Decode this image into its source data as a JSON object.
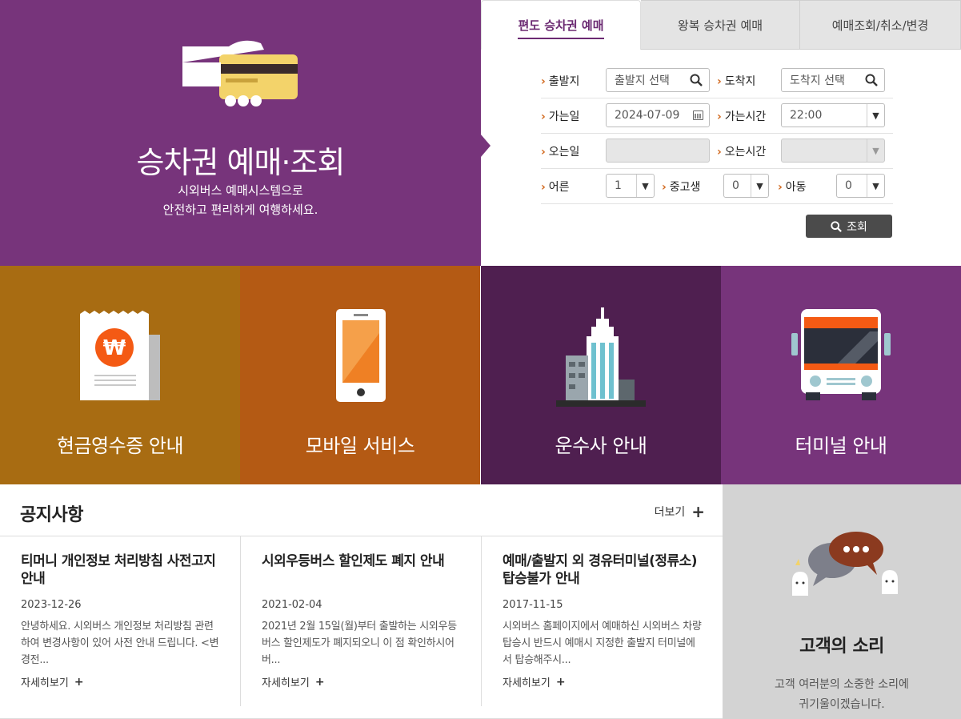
{
  "hero": {
    "title": "승차권 예매·조회",
    "subtitle_line1": "시외버스 예매시스템으로",
    "subtitle_line2": "안전하고 편리하게 여행하세요."
  },
  "tabs": [
    {
      "label": "편도 승차권 예매",
      "active": true
    },
    {
      "label": "왕복 승차권 예매",
      "active": false
    },
    {
      "label": "예매조회/취소/변경",
      "active": false
    }
  ],
  "form": {
    "departure_label": "출발지",
    "departure_placeholder": "출발지 선택",
    "arrival_label": "도착지",
    "arrival_placeholder": "도착지 선택",
    "go_date_label": "가는일",
    "go_date_value": "2024-07-09",
    "go_time_label": "가는시간",
    "go_time_value": "22:00",
    "return_date_label": "오는일",
    "return_time_label": "오는시간",
    "adult_label": "어른",
    "adult_value": "1",
    "student_label": "중고생",
    "student_value": "0",
    "child_label": "아동",
    "child_value": "0",
    "search_label": "조회"
  },
  "tiles": [
    {
      "label": "현금영수증 안내",
      "color": "#a86c12"
    },
    {
      "label": "모바일 서비스",
      "color": "#b45a14"
    },
    {
      "label": "운수사 안내",
      "color": "#4f1f50"
    },
    {
      "label": "터미널 안내",
      "color": "#77347b"
    }
  ],
  "notices": {
    "title": "공지사항",
    "more_label": "더보기",
    "items": [
      {
        "title": "티머니 개인정보 처리방침 사전고지 안내",
        "date": "2023-12-26",
        "body": "안녕하세요. 시외버스 개인정보 처리방침 관련하여 변경사항이 있어 사전 안내 드립니다. <변경전...",
        "detail": "자세히보기"
      },
      {
        "title": "시외우등버스 할인제도 폐지 안내",
        "date": "2021-02-04",
        "body": "2021년 2월 15일(월)부터 출발하는 시외우등버스 할인제도가 폐지되오니 이 점 확인하시어 버...",
        "detail": "자세히보기"
      },
      {
        "title": "예매/출발지 외 경유터미널(정류소) 탑승불가 안내",
        "date": "2017-11-15",
        "body": "시외버스 홈페이지에서 예매하신 시외버스 차량탑승시 반드시 예매시 지정한 출발지 터미널에서 탑승해주시...",
        "detail": "자세히보기"
      }
    ]
  },
  "voc": {
    "title": "고객의 소리",
    "desc_line1": "고객 여러분의 소중한 소리에",
    "desc_line2": "귀기울이겠습니다."
  }
}
